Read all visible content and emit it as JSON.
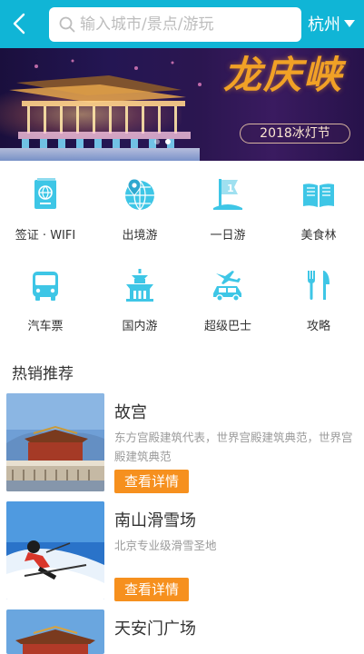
{
  "header": {
    "search_placeholder": "输入城市/景点/游玩",
    "city": "杭州"
  },
  "banner": {
    "title": "龙庆峡",
    "tag": "2018冰灯节",
    "dots": 2,
    "active_dot": 1
  },
  "categories": [
    {
      "label": "签证 · WIFI",
      "icon": "visa-passport-icon"
    },
    {
      "label": "出境游",
      "icon": "globe-location-icon"
    },
    {
      "label": "一日游",
      "icon": "flag-one-icon"
    },
    {
      "label": "美食林",
      "icon": "open-book-icon"
    },
    {
      "label": "汽车票",
      "icon": "bus-icon"
    },
    {
      "label": "国内游",
      "icon": "temple-icon"
    },
    {
      "label": "超级巴士",
      "icon": "plane-car-icon"
    },
    {
      "label": "攻略",
      "icon": "fork-knife-icon"
    }
  ],
  "section": {
    "title": "热销推荐"
  },
  "products": [
    {
      "name": "故宫",
      "desc": "东方宫殿建筑代表，世界宫殿建筑典范，世界宫殿建筑典范",
      "button": "查看详情"
    },
    {
      "name": "南山滑雪场",
      "desc": "北京专业级滑雪圣地",
      "button": "查看详情"
    },
    {
      "name": "天安门广场",
      "desc": "",
      "button": ""
    }
  ],
  "colors": {
    "primary": "#10b5d6",
    "accent": "#f6901e",
    "icon": "#3ec6e6"
  }
}
